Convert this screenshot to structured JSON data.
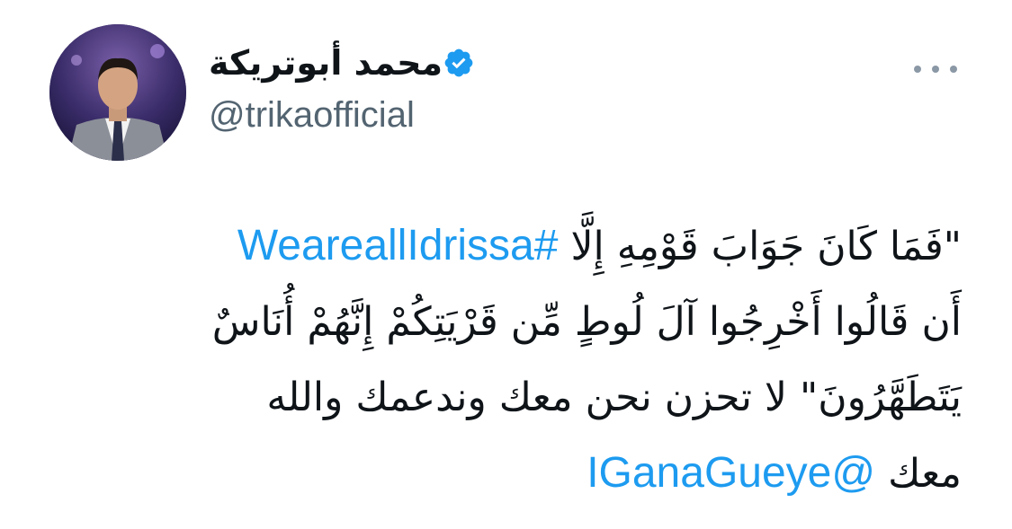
{
  "author": {
    "display_name": "محمد أبوتريكة",
    "handle": "@trikaofficial",
    "verified": true
  },
  "tweet": {
    "line1_text": "\"فَمَا كَانَ جَوَابَ قَوْمِهِ إِلَّا",
    "hashtag": "#WeareallIdrissa",
    "line2_text": "أَن قَالُوا أَخْرِجُوا آلَ لُوطٍ مِّن قَرْيَتِكُمْ إِنَّهُمْ أُنَاسٌ",
    "line3_text": "يَتَطَهَّرُونَ\" لا تحزن نحن معك وندعمك والله",
    "line4_text": "معك",
    "mention": "@IGanaGueye"
  },
  "colors": {
    "link": "#1d9bf0",
    "handle": "#536471",
    "verified": "#1d9bf0"
  },
  "icons": {
    "verified": "verified-badge-icon",
    "more": "more-options-icon"
  }
}
